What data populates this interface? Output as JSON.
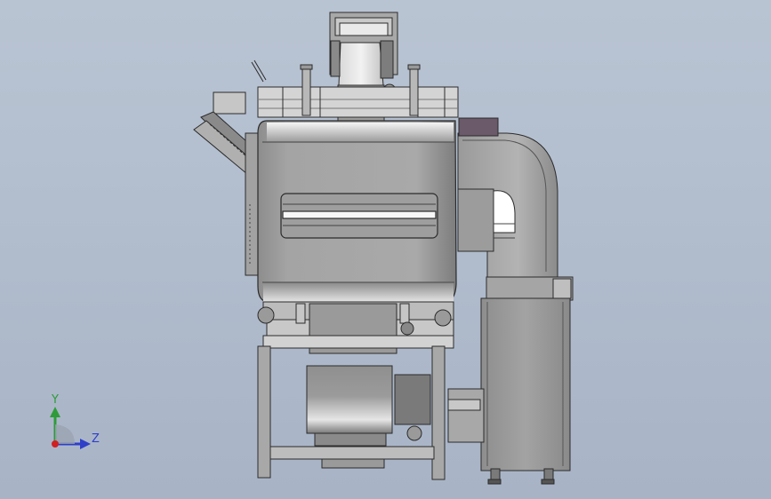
{
  "viewport": {
    "background_top": "#b9c4d3",
    "background_bottom": "#a8b4c6"
  },
  "axis_triad": {
    "y_label": "Y",
    "z_label": "Z",
    "y_color": "#2f9b3a",
    "z_color": "#2f3fc8",
    "origin_color": "#d02020"
  },
  "palette": {
    "outline": "#2b2b2b",
    "metal_light": "#d9d9d9",
    "metal_mid": "#a9a9a9",
    "metal_dark": "#6e6e6e",
    "housing_accent": "#6a5a6a"
  }
}
